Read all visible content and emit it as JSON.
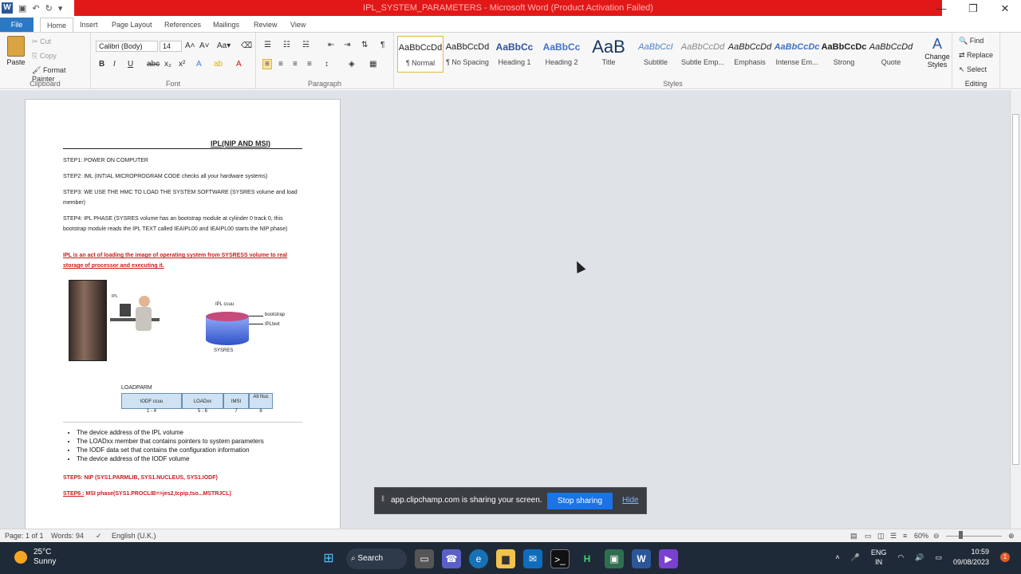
{
  "titlebar": {
    "title": "IPL_SYSTEM_PARAMETERS - Microsoft Word (Product Activation Failed)",
    "app_icon": "W",
    "minimize": "—",
    "restore": "❐",
    "close": "✕"
  },
  "tabs": [
    "File",
    "Home",
    "Insert",
    "Page Layout",
    "References",
    "Mailings",
    "Review",
    "View"
  ],
  "clipboard": {
    "paste": "Paste",
    "cut": "Cut",
    "copy": "Copy",
    "format_painter": "Format Painter",
    "group": "Clipboard"
  },
  "font": {
    "name": "Calibri (Body)",
    "size": "14",
    "group": "Font"
  },
  "paragraph": {
    "group": "Paragraph"
  },
  "styles": {
    "group": "Styles",
    "items": [
      {
        "sample": "AaBbCcDd",
        "name": "¶ Normal"
      },
      {
        "sample": "AaBbCcDd",
        "name": "¶ No Spacing"
      },
      {
        "sample": "AaBbCc",
        "name": "Heading 1"
      },
      {
        "sample": "AaBbCc",
        "name": "Heading 2"
      },
      {
        "sample": "AaB",
        "name": "Title"
      },
      {
        "sample": "AaBbCcI",
        "name": "Subtitle"
      },
      {
        "sample": "AaBbCcDd",
        "name": "Subtle Emp..."
      },
      {
        "sample": "AaBbCcDd",
        "name": "Emphasis"
      },
      {
        "sample": "AaBbCcDc",
        "name": "Intense Em..."
      },
      {
        "sample": "AaBbCcDc",
        "name": "Strong"
      },
      {
        "sample": "AaBbCcDd",
        "name": "Quote"
      }
    ],
    "change_styles": "Change Styles"
  },
  "editing": {
    "find": "Find",
    "replace": "Replace",
    "select": "Select",
    "group": "Editing"
  },
  "document": {
    "title": "IPL(NIP AND MSI)",
    "step1": "STEP1: POWER ON COMPUTER",
    "step2": "STEP2: IML (INTIAL MICROPROGRAM CODE checks all your hardware systems)",
    "step3": "STEP3: WE USE THE HMC TO LOAD THE SYSTEM SOFTWARE (SYSRES volume and load member)",
    "step4": "STEP4: IPL PHASE (SYSRES volume has an bootstrap module at cylinder 0 track 0, this bootstrap module reads the IPL TEXT called IEAIPL00 and IEAIPL00 starts the NIP phase)",
    "ipl_def": "IPL is an act of loading the image of operating system from SYSRESS volume to real storage of processor and executing it.",
    "disk_label_top": "IPL ccuu",
    "disk_label_bootstrap": "bootstrap",
    "disk_label_ipltext": "IPLtext",
    "disk_label_bottom": "SYSRES",
    "computer_label": "IPL",
    "loadparm_title": "LOADPARM",
    "loadparm_cells": [
      "IODF ccuu",
      "LOADxx",
      "IMSI",
      "Alt Nuc"
    ],
    "loadparm_nums": [
      "1 - 4",
      "5 - 6",
      "7",
      "8"
    ],
    "bullets": [
      "The device address of the IPL volume",
      "The LOADxx member that contains pointers to system parameters",
      "The IODF data set that contains the configuration information",
      "The device address of the IODF volume"
    ],
    "step5": "STEP5: NIP (SYS1.PARMLIB, SYS1.NUCLEUS, SYS1.IODF)",
    "step6_label": "STEP6 :",
    "step6_text": "MSI phase(SYS1.PROCLIB=>jes2,tcpip,tso...MSTRJCL)"
  },
  "share": {
    "message": "app.clipchamp.com is sharing your screen.",
    "stop": "Stop sharing",
    "hide": "Hide"
  },
  "status": {
    "page": "Page: 1 of 1",
    "words": "Words: 94",
    "language": "English (U.K.)",
    "zoom": "60%"
  },
  "taskbar": {
    "temp": "25°C",
    "weather": "Sunny",
    "search": "Search",
    "lang1": "ENG",
    "lang2": "IN",
    "time": "10:59",
    "date": "09/08/2023",
    "notif": "1"
  }
}
